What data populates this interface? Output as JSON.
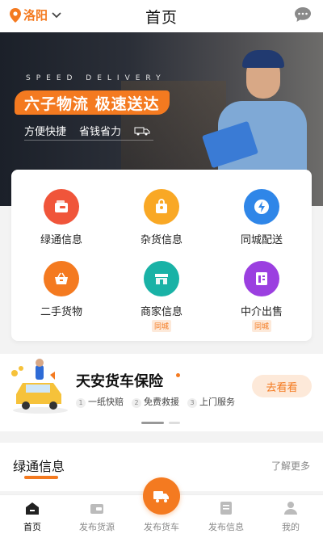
{
  "header": {
    "location": "洛阳",
    "title": "首页"
  },
  "banner": {
    "tagline_en": "SPEED DELIVERY",
    "slogan": "六子物流 极速送达",
    "sub1": "方便快捷",
    "sub2": "省钱省力"
  },
  "categories": [
    {
      "label": "绿通信息",
      "color": "#f0553a",
      "icon": "wallet-icon",
      "tag": ""
    },
    {
      "label": "杂货信息",
      "color": "#f9a825",
      "icon": "bag-icon",
      "tag": ""
    },
    {
      "label": "同城配送",
      "color": "#2f86e8",
      "icon": "lightning-icon",
      "tag": ""
    },
    {
      "label": "二手货物",
      "color": "#f47a20",
      "icon": "basket-icon",
      "tag": ""
    },
    {
      "label": "商家信息",
      "color": "#19b2a6",
      "icon": "store-icon",
      "tag": "同城"
    },
    {
      "label": "中介出售",
      "color": "#9b3fe0",
      "icon": "document-icon",
      "tag": "同城"
    }
  ],
  "insurance": {
    "title": "天安货车保险",
    "features": [
      {
        "num": "1",
        "text": "一纸快赔"
      },
      {
        "num": "2",
        "text": "免费救援"
      },
      {
        "num": "3",
        "text": "上门服务"
      }
    ],
    "button": "去看看"
  },
  "section": {
    "title": "绿通信息",
    "more": "了解更多"
  },
  "tabs": [
    {
      "label": "首页",
      "icon": "home-icon"
    },
    {
      "label": "发布货源",
      "icon": "wallet-icon"
    },
    {
      "label": "发布货车",
      "icon": "truck-icon"
    },
    {
      "label": "发布信息",
      "icon": "document-icon"
    },
    {
      "label": "我的",
      "icon": "user-icon"
    }
  ],
  "colors": {
    "accent": "#f47a20"
  }
}
